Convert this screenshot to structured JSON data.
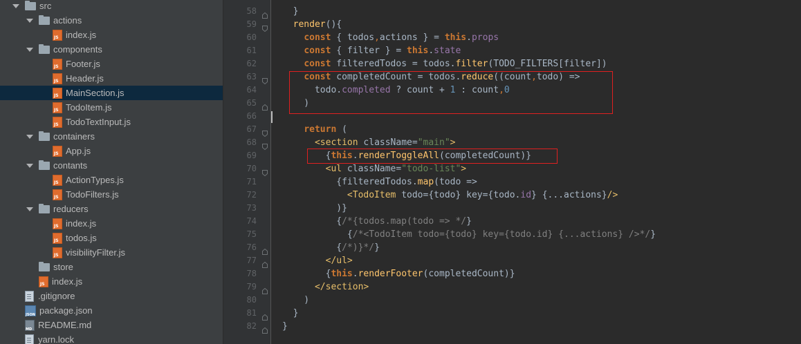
{
  "tree": {
    "rows": [
      {
        "label": "src",
        "type": "folder",
        "depth": 0,
        "open": true
      },
      {
        "label": "actions",
        "type": "folder",
        "depth": 1,
        "open": true
      },
      {
        "label": "index.js",
        "type": "js",
        "depth": 2
      },
      {
        "label": "components",
        "type": "folder",
        "depth": 1,
        "open": true
      },
      {
        "label": "Footer.js",
        "type": "js",
        "depth": 2
      },
      {
        "label": "Header.js",
        "type": "js",
        "depth": 2
      },
      {
        "label": "MainSection.js",
        "type": "js",
        "depth": 2,
        "selected": true
      },
      {
        "label": "TodoItem.js",
        "type": "js",
        "depth": 2
      },
      {
        "label": "TodoTextInput.js",
        "type": "js",
        "depth": 2
      },
      {
        "label": "containers",
        "type": "folder",
        "depth": 1,
        "open": true
      },
      {
        "label": "App.js",
        "type": "js",
        "depth": 2
      },
      {
        "label": "contants",
        "type": "folder",
        "depth": 1,
        "open": true
      },
      {
        "label": "ActionTypes.js",
        "type": "js",
        "depth": 2
      },
      {
        "label": "TodoFilters.js",
        "type": "js",
        "depth": 2
      },
      {
        "label": "reducers",
        "type": "folder",
        "depth": 1,
        "open": true
      },
      {
        "label": "index.js",
        "type": "js",
        "depth": 2
      },
      {
        "label": "todos.js",
        "type": "js",
        "depth": 2
      },
      {
        "label": "visibilityFilter.js",
        "type": "js",
        "depth": 2
      },
      {
        "label": "store",
        "type": "folder",
        "depth": 1,
        "open": false
      },
      {
        "label": "index.js",
        "type": "js",
        "depth": 1
      },
      {
        "label": ".gitignore",
        "type": "plain",
        "depth": 0
      },
      {
        "label": "package.json",
        "type": "json",
        "depth": 0
      },
      {
        "label": "README.md",
        "type": "md",
        "depth": 0
      },
      {
        "label": "yarn.lock",
        "type": "plain",
        "depth": 0
      }
    ]
  },
  "editor": {
    "line_numbers": [
      "58",
      "59",
      "60",
      "61",
      "62",
      "63",
      "64",
      "65",
      "66",
      "67",
      "68",
      "69",
      "70",
      "71",
      "72",
      "73",
      "74",
      "75",
      "76",
      "77",
      "78",
      "79",
      "80",
      "81",
      "82"
    ],
    "lines": [
      [
        {
          "t": "  }",
          "c": ""
        }
      ],
      [
        {
          "t": "  ",
          "c": ""
        },
        {
          "t": "render",
          "c": "fn"
        },
        {
          "t": "(){",
          "c": ""
        }
      ],
      [
        {
          "t": "    ",
          "c": ""
        },
        {
          "t": "const",
          "c": "kw"
        },
        {
          "t": " { ",
          "c": ""
        },
        {
          "t": "todos",
          "c": ""
        },
        {
          "t": ",",
          "c": "punc"
        },
        {
          "t": "actions } = ",
          "c": ""
        },
        {
          "t": "this",
          "c": "this"
        },
        {
          "t": ".",
          "c": ""
        },
        {
          "t": "props",
          "c": "prop"
        }
      ],
      [
        {
          "t": "    ",
          "c": ""
        },
        {
          "t": "const",
          "c": "kw"
        },
        {
          "t": " { filter } = ",
          "c": ""
        },
        {
          "t": "this",
          "c": "this"
        },
        {
          "t": ".",
          "c": ""
        },
        {
          "t": "state",
          "c": "prop"
        }
      ],
      [
        {
          "t": "    ",
          "c": ""
        },
        {
          "t": "const",
          "c": "kw"
        },
        {
          "t": " filteredTodos = todos.",
          "c": ""
        },
        {
          "t": "filter",
          "c": "fn"
        },
        {
          "t": "(TODO_FILTERS[filter])",
          "c": ""
        }
      ],
      [
        {
          "t": "    ",
          "c": ""
        },
        {
          "t": "const",
          "c": "kw"
        },
        {
          "t": " completedCount = todos.",
          "c": ""
        },
        {
          "t": "reduce",
          "c": "fn"
        },
        {
          "t": "((count",
          "c": ""
        },
        {
          "t": ",",
          "c": "punc"
        },
        {
          "t": "todo) =>",
          "c": ""
        }
      ],
      [
        {
          "t": "      todo.",
          "c": ""
        },
        {
          "t": "completed",
          "c": "prop"
        },
        {
          "t": " ? count + ",
          "c": ""
        },
        {
          "t": "1",
          "c": "num"
        },
        {
          "t": " : count",
          "c": ""
        },
        {
          "t": ",",
          "c": "punc"
        },
        {
          "t": "0",
          "c": "num"
        }
      ],
      [
        {
          "t": "    )",
          "c": ""
        }
      ],
      [
        {
          "t": "",
          "c": ""
        }
      ],
      [
        {
          "t": "    ",
          "c": ""
        },
        {
          "t": "return",
          "c": "kw"
        },
        {
          "t": " (",
          "c": ""
        }
      ],
      [
        {
          "t": "      ",
          "c": ""
        },
        {
          "t": "<section",
          "c": "tag"
        },
        {
          "t": " className=",
          "c": ""
        },
        {
          "t": "\"main\"",
          "c": "str"
        },
        {
          "t": ">",
          "c": "tag"
        }
      ],
      [
        {
          "t": "        {",
          "c": ""
        },
        {
          "t": "this",
          "c": "this"
        },
        {
          "t": ".",
          "c": ""
        },
        {
          "t": "renderToggleAll",
          "c": "fn"
        },
        {
          "t": "(completedCount)}",
          "c": ""
        }
      ],
      [
        {
          "t": "        ",
          "c": ""
        },
        {
          "t": "<ul",
          "c": "tag"
        },
        {
          "t": " className=",
          "c": ""
        },
        {
          "t": "\"todo-list\"",
          "c": "str"
        },
        {
          "t": ">",
          "c": "tag"
        }
      ],
      [
        {
          "t": "          {filteredTodos.",
          "c": ""
        },
        {
          "t": "map",
          "c": "fn"
        },
        {
          "t": "(todo =>",
          "c": ""
        }
      ],
      [
        {
          "t": "            ",
          "c": ""
        },
        {
          "t": "<TodoItem",
          "c": "tag"
        },
        {
          "t": " todo={todo} key={todo.",
          "c": ""
        },
        {
          "t": "id",
          "c": "prop"
        },
        {
          "t": "} {...actions}",
          "c": ""
        },
        {
          "t": "/>",
          "c": "tag"
        }
      ],
      [
        {
          "t": "          )}",
          "c": ""
        }
      ],
      [
        {
          "t": "          {",
          "c": ""
        },
        {
          "t": "/*{todos.map(todo => */",
          "c": "cmt"
        },
        {
          "t": "}",
          "c": ""
        }
      ],
      [
        {
          "t": "            {",
          "c": ""
        },
        {
          "t": "/*<TodoItem todo={todo} key={todo.id} {...actions} />*/",
          "c": "cmt"
        },
        {
          "t": "}",
          "c": ""
        }
      ],
      [
        {
          "t": "          {",
          "c": ""
        },
        {
          "t": "/*)}*/",
          "c": "cmt"
        },
        {
          "t": "}",
          "c": ""
        }
      ],
      [
        {
          "t": "        ",
          "c": ""
        },
        {
          "t": "</ul>",
          "c": "tag"
        }
      ],
      [
        {
          "t": "        {",
          "c": ""
        },
        {
          "t": "this",
          "c": "this"
        },
        {
          "t": ".",
          "c": ""
        },
        {
          "t": "renderFooter",
          "c": "fn"
        },
        {
          "t": "(completedCount)}",
          "c": ""
        }
      ],
      [
        {
          "t": "      ",
          "c": ""
        },
        {
          "t": "</section>",
          "c": "tag"
        }
      ],
      [
        {
          "t": "    )",
          "c": ""
        }
      ],
      [
        {
          "t": "  }",
          "c": ""
        }
      ],
      [
        {
          "t": "}",
          "c": ""
        }
      ]
    ]
  }
}
